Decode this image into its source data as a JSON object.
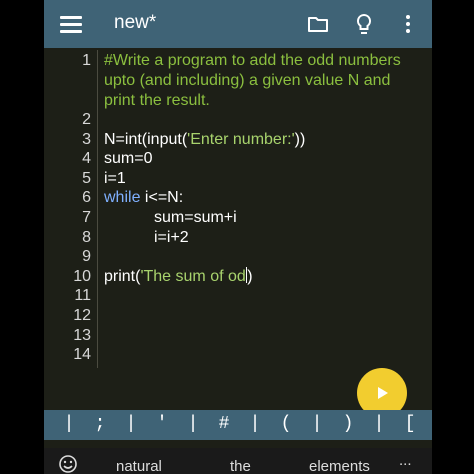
{
  "app": {
    "title": "new*"
  },
  "toolbar": {
    "icons": [
      "menu-icon",
      "folder-icon",
      "lightbulb-icon",
      "more-vert-icon"
    ]
  },
  "editor": {
    "line_numbers": [
      "1",
      "2",
      "3",
      "4",
      "5",
      "6",
      "7",
      "8",
      "9",
      "10",
      "11",
      "12",
      "13",
      "14"
    ],
    "comment": [
      "#Write a program to add the odd numbers",
      "upto (and including) a given value N and",
      "print the result."
    ],
    "l3_a": "N=int(input(",
    "l3_b": "'Enter number:'",
    "l3_c": "))",
    "l4": "sum=0",
    "l5": "i=1",
    "l6_kw": "while",
    "l6_rest": " i<=N:",
    "l7": "sum=sum+i",
    "l8": "i=i+2",
    "l10_a": "print(",
    "l10_b": "'The sum of od",
    "l10_c": ")"
  },
  "run_button": {
    "icon": "play-icon"
  },
  "symbols": [
    "|",
    ";",
    "|",
    "'",
    "|",
    "#",
    "|",
    "(",
    "|",
    ")",
    "|",
    "["
  ],
  "suggestions": {
    "emoji_icon": "emoji-icon",
    "words": [
      "natural",
      "the",
      "elements"
    ],
    "more": "..."
  },
  "colors": {
    "appbar": "#3f6376",
    "background": "#1d1f17",
    "comment": "#8bbf3f",
    "keyword": "#7fb0ff",
    "fab": "#f2cd2f"
  }
}
